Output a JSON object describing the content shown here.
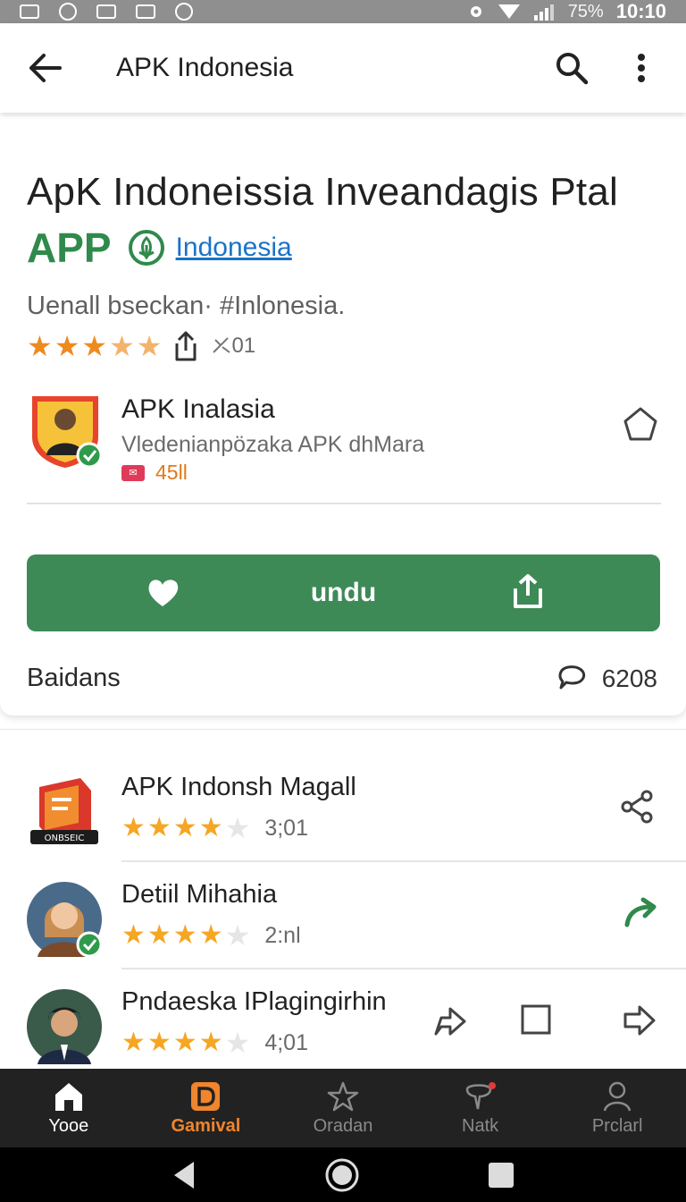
{
  "status_bar": {
    "battery": "75%",
    "time": "10:10"
  },
  "app_bar": {
    "title": "APK Indonesia"
  },
  "header": {
    "title": "ApK Indoneissia Inveandagis Ptal",
    "app_word": "APP",
    "link_text": "Indonesia",
    "subtitle": "Uenall bseckan· #Inlonesia.",
    "rating_count": "01"
  },
  "developer": {
    "name": "APK Inalasia",
    "subtitle": "Vledenianpözaka APK dhMara",
    "count": "45ll"
  },
  "cta": {
    "label": "undu"
  },
  "footer": {
    "label": "Baidans",
    "comment_count": "6208"
  },
  "list": [
    {
      "name": "APK Indonsh Magall",
      "rating": "3;01",
      "stars": 4,
      "badge_text": "ONBSEIC"
    },
    {
      "name": "Detiil Mihahia",
      "rating": "2:nl",
      "stars": 4
    },
    {
      "name": "Pndaeska IPlagingirhin",
      "rating": "4;01",
      "stars": 4
    }
  ],
  "bottom_nav": [
    {
      "label": "Yooe",
      "icon": "home-icon"
    },
    {
      "label": "Gamival",
      "icon": "d-square-icon"
    },
    {
      "label": "Oradan",
      "icon": "star-outline-icon"
    },
    {
      "label": "Natk",
      "icon": "bubble-icon"
    },
    {
      "label": "Prclarl",
      "icon": "person-icon"
    }
  ],
  "colors": {
    "primary_green": "#3d8a57",
    "link": "#1a73c8",
    "star": "#f5a623",
    "active_nav": "#f0852d"
  }
}
